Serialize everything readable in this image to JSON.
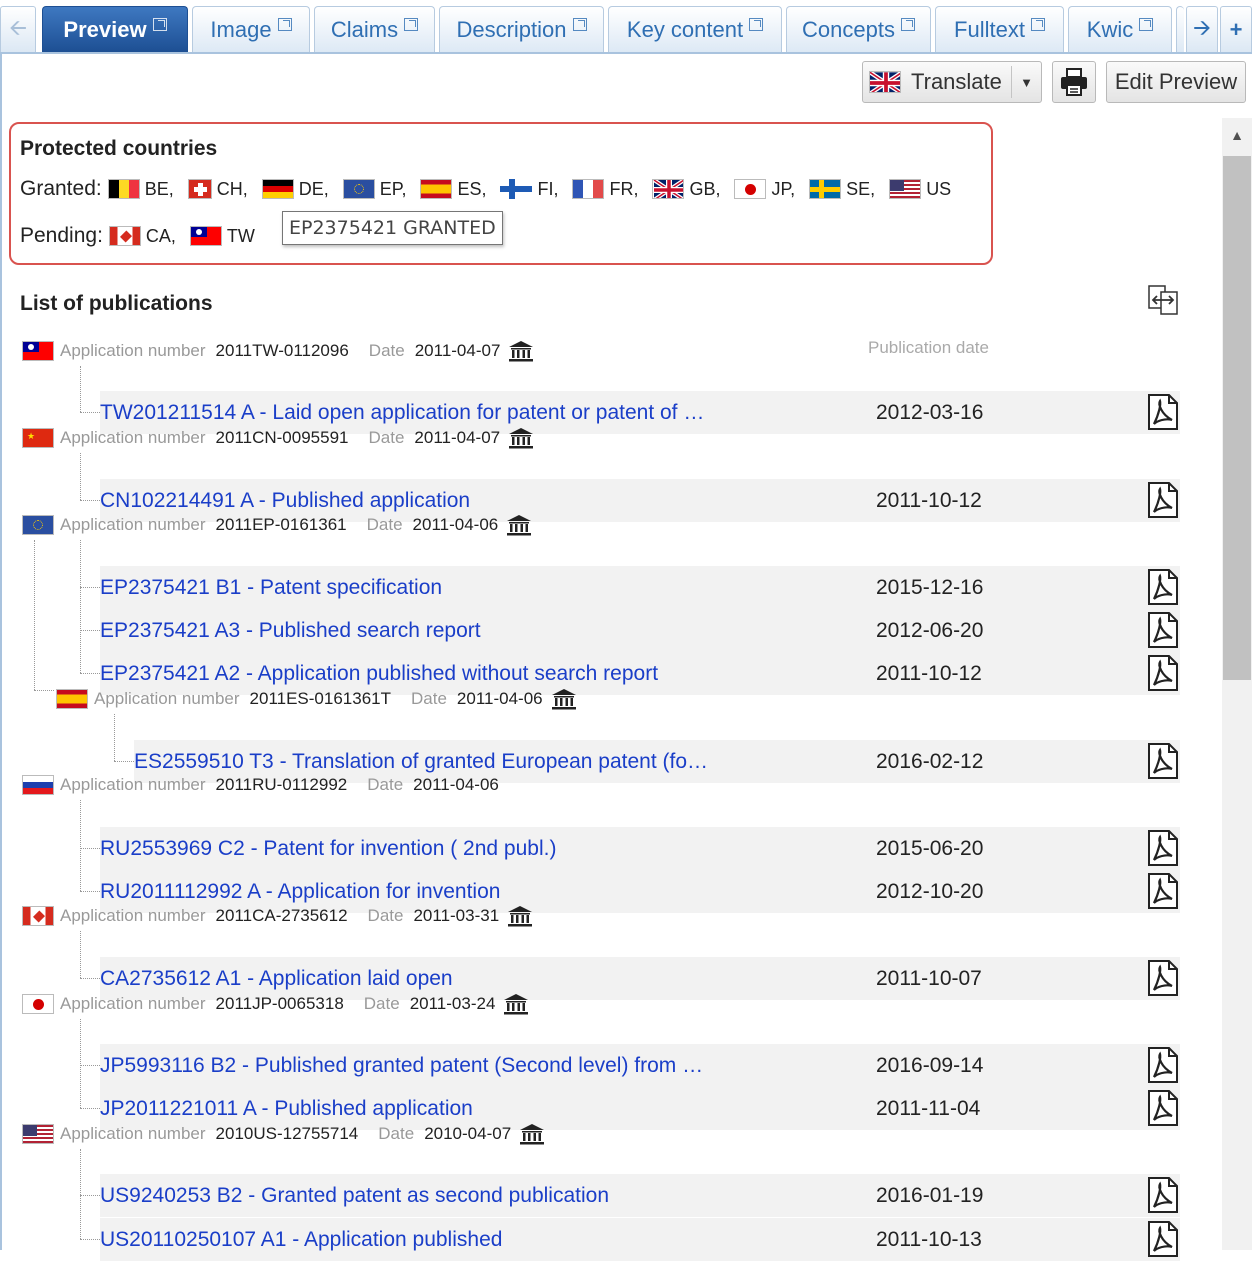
{
  "tabs": [
    {
      "label": "Preview",
      "active": true
    },
    {
      "label": "Image"
    },
    {
      "label": "Claims"
    },
    {
      "label": "Description"
    },
    {
      "label": "Key content"
    },
    {
      "label": "Concepts"
    },
    {
      "label": "Fulltext"
    },
    {
      "label": "Kwic"
    }
  ],
  "toolbar": {
    "translate_label": "Translate",
    "edit_preview_label": "Edit Preview"
  },
  "protected": {
    "title": "Protected countries",
    "granted_label": "Granted:",
    "pending_label": "Pending:",
    "granted": [
      "BE,",
      "CH,",
      "DE,",
      "EP,",
      "ES,",
      "FI,",
      "FR,",
      "GB,",
      "JP,",
      "SE,",
      "US"
    ],
    "pending": [
      "CA,",
      "TW"
    ],
    "tooltip": "EP2375421 GRANTED"
  },
  "publications": {
    "title": "List of publications",
    "pub_date_header": "Publication date",
    "app_number_label": "Application number",
    "date_label": "Date",
    "families": [
      {
        "flag": "TW",
        "app_number": "2011TW-0112096",
        "date": "2011-04-07",
        "items": [
          {
            "id": "TW201211514  A - Laid open application for patent or patent of …",
            "date": "2012-03-16"
          }
        ]
      },
      {
        "flag": "CN",
        "app_number": "2011CN-0095591",
        "date": "2011-04-07",
        "items": [
          {
            "id": "CN102214491  A - Published application",
            "date": "2011-10-12"
          }
        ]
      },
      {
        "flag": "EP",
        "app_number": "2011EP-0161361",
        "date": "2011-04-06",
        "items": [
          {
            "id": "EP2375421  B1 - Patent specification",
            "date": "2015-12-16"
          },
          {
            "id": "EP2375421  A3 - Published search report",
            "date": "2012-06-20"
          },
          {
            "id": "EP2375421  A2 - Application published without search report",
            "date": "2011-10-12"
          }
        ]
      },
      {
        "flag": "ES",
        "app_number": "2011ES-0161361T",
        "date": "2011-04-06",
        "items": [
          {
            "id": "ES2559510  T3 - Translation of granted European patent (fo…",
            "date": "2016-02-12"
          }
        ]
      },
      {
        "flag": "RU",
        "app_number": "2011RU-0112992",
        "date": "2011-04-06",
        "items": [
          {
            "id": "RU2553969  C2 - Patent for invention ( 2nd publ.)",
            "date": "2015-06-20"
          },
          {
            "id": "RU2011112992  A - Application for invention",
            "date": "2012-10-20"
          }
        ]
      },
      {
        "flag": "CA",
        "app_number": "2011CA-2735612",
        "date": "2011-03-31",
        "items": [
          {
            "id": "CA2735612  A1 - Application laid open",
            "date": "2011-10-07"
          }
        ]
      },
      {
        "flag": "JP",
        "app_number": "2011JP-0065318",
        "date": "2011-03-24",
        "items": [
          {
            "id": "JP5993116  B2 - Published granted patent (Second level) from …",
            "date": "2016-09-14"
          },
          {
            "id": "JP2011221011  A - Published application",
            "date": "2011-11-04"
          }
        ]
      },
      {
        "flag": "US",
        "app_number": "2010US-12755714",
        "date": "2010-04-07",
        "items": [
          {
            "id": "US9240253  B2 - Granted patent as second publication",
            "date": "2016-01-19"
          },
          {
            "id": "US20110250107  A1 - Application published",
            "date": "2011-10-13"
          }
        ]
      }
    ]
  },
  "colors": {
    "link": "#1a3ec8",
    "tab_active": "#1d4f93",
    "highlight_border": "#d9534f"
  }
}
